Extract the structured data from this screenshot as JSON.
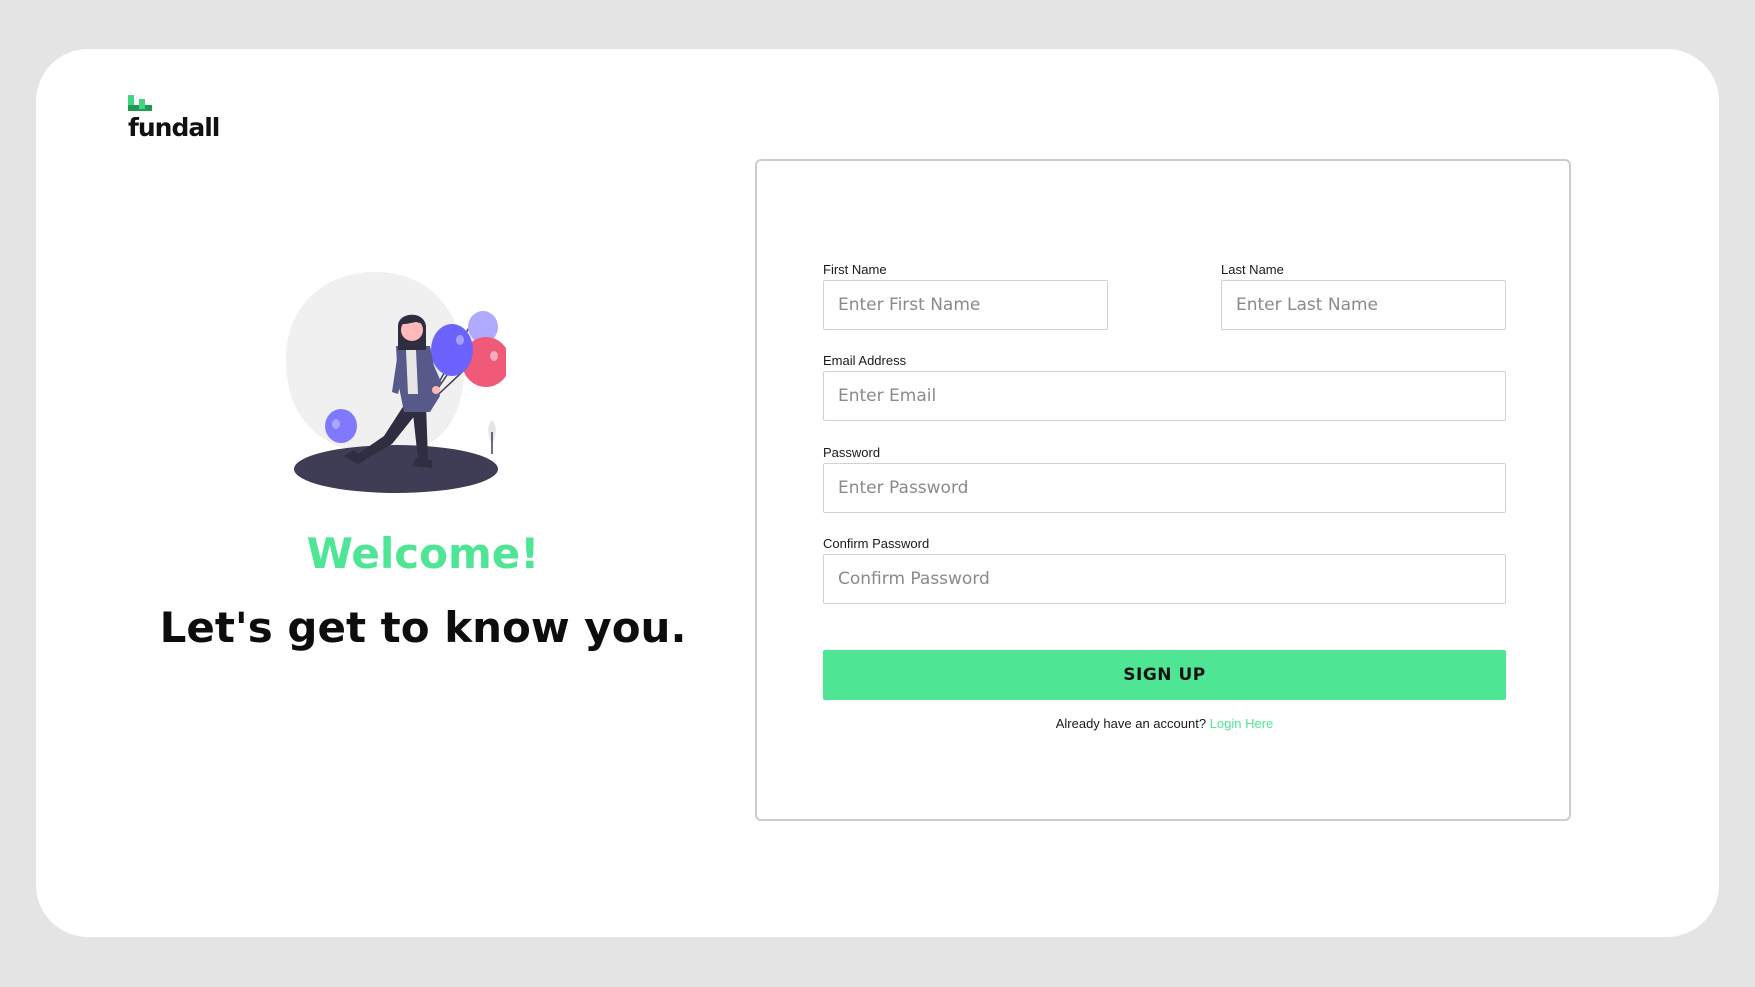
{
  "brand": {
    "name": "fundall",
    "accent_color": "#4ee694"
  },
  "hero": {
    "welcome": "Welcome!",
    "tagline": "Let's get to know you."
  },
  "form": {
    "first_name": {
      "label": "First Name",
      "placeholder": "Enter First Name",
      "value": ""
    },
    "last_name": {
      "label": "Last Name",
      "placeholder": "Enter Last Name",
      "value": ""
    },
    "email": {
      "label": "Email Address",
      "placeholder": "Enter Email",
      "value": ""
    },
    "password": {
      "label": "Password",
      "placeholder": "Enter Password",
      "value": ""
    },
    "confirm_password": {
      "label": "Confirm Password",
      "placeholder": "Confirm Password",
      "value": ""
    },
    "submit_label": "SIGN UP",
    "login_prompt": "Already have an account?",
    "login_link": "Login Here"
  },
  "icons": {
    "logo": "fundall-logo-icon",
    "illustration": "woman-with-balloons-illustration"
  }
}
